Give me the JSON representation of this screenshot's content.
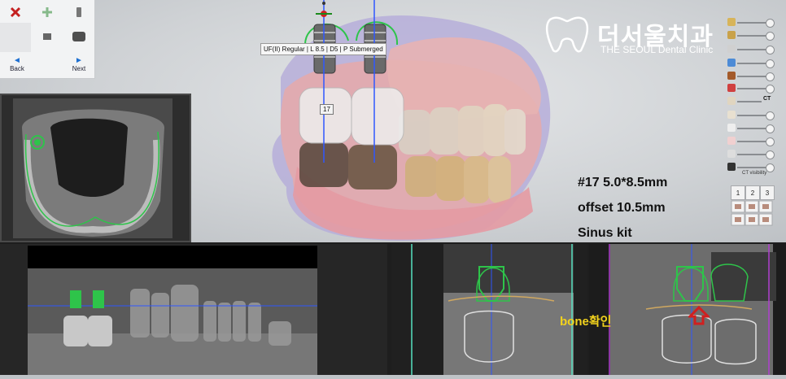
{
  "toolbar": {
    "back_label": "Back",
    "next_label": "Next"
  },
  "brand": {
    "name": "더서울치과",
    "subtitle": "THE SEOUL Dental Clinic"
  },
  "implant_label": "UF(II) Regular | L 8.5 | D5 | P Submerged",
  "tooth_tag": "17",
  "info": {
    "line1": "#17 5.0*8.5mm",
    "line2": "offset 10.5mm",
    "line3": "Sinus kit"
  },
  "right_panel": {
    "ct_label": "CT",
    "ct_visibility": "CT visibility",
    "view_numbers": [
      "1",
      "2",
      "3"
    ]
  },
  "annotation": "bone확인",
  "colors": {
    "implant_green": "#2ec44a",
    "axis_blue": "#2f57ff",
    "marker_red": "#d02020",
    "annotation_yellow": "#f2d21d",
    "nav_blue": "#1d6fd1"
  }
}
